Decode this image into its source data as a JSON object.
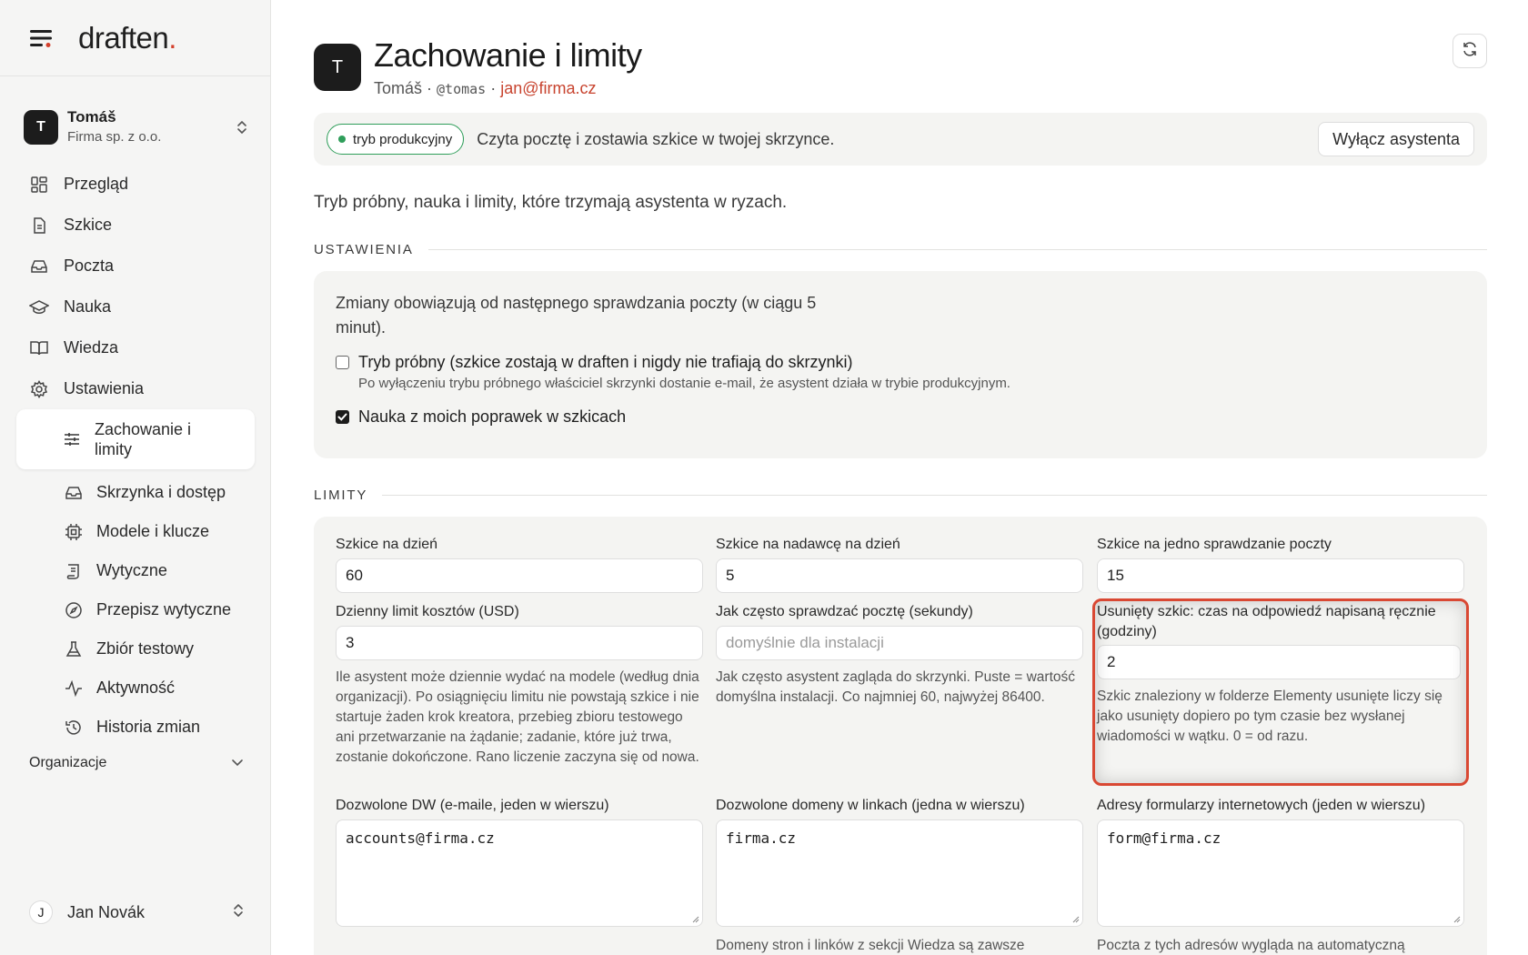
{
  "brand": {
    "name": "draften",
    "dot": "."
  },
  "workspace": {
    "avatar": "T",
    "name": "Tomáš",
    "org": "Firma sp. z o.o."
  },
  "nav": {
    "items": [
      {
        "label": "Przegląd",
        "icon": "dashboard-icon"
      },
      {
        "label": "Szkice",
        "icon": "document-icon"
      },
      {
        "label": "Poczta",
        "icon": "inbox-icon"
      },
      {
        "label": "Nauka",
        "icon": "graduation-cap-icon"
      },
      {
        "label": "Wiedza",
        "icon": "book-icon"
      },
      {
        "label": "Ustawienia",
        "icon": "gear-icon"
      }
    ],
    "sub_items": [
      {
        "label": "Zachowanie i limity",
        "icon": "sliders-icon",
        "active": true
      },
      {
        "label": "Skrzynka i dostęp",
        "icon": "inbox-icon"
      },
      {
        "label": "Modele i klucze",
        "icon": "chip-icon"
      },
      {
        "label": "Wytyczne",
        "icon": "scroll-icon"
      },
      {
        "label": "Przepisz wytyczne",
        "icon": "compass-icon"
      },
      {
        "label": "Zbiór testowy",
        "icon": "flask-icon"
      },
      {
        "label": "Aktywność",
        "icon": "activity-icon"
      },
      {
        "label": "Historia zmian",
        "icon": "history-icon"
      }
    ]
  },
  "org_section": {
    "label": "Organizacje"
  },
  "user": {
    "avatar": "J",
    "name": "Jan Novák"
  },
  "header": {
    "avatar": "T",
    "title": "Zachowanie i limity",
    "name": "Tomáš",
    "sep1": " · ",
    "handle": "@tomas",
    "sep2": " · ",
    "email": "jan@firma.cz"
  },
  "status": {
    "badge": "tryb produkcyjny",
    "text": "Czyta pocztę i zostawia szkice w twojej skrzynce.",
    "button": "Wyłącz asystenta",
    "badge_color": "#2f9e5a"
  },
  "intro": "Tryb próbny, nauka i limity, które trzymają asystenta w ryzach.",
  "settings": {
    "heading": "USTAWIENIA",
    "note": "Zmiany obowiązują od następnego sprawdzania poczty (w ciągu 5 minut).",
    "trial": {
      "label": "Tryb próbny (szkice zostają w draften i nigdy nie trafiają do skrzynki)",
      "help": "Po wyłączeniu trybu próbnego właściciel skrzynki dostanie e-mail, że asystent działa w trybie produkcyjnym.",
      "checked": false
    },
    "learn": {
      "label": "Nauka z moich poprawek w szkicach",
      "checked": true
    }
  },
  "limits": {
    "heading": "LIMITY",
    "drafts_per_day": {
      "label": "Szkice na dzień",
      "value": "60"
    },
    "drafts_per_sender": {
      "label": "Szkice na nadawcę na dzień",
      "value": "5"
    },
    "drafts_per_check": {
      "label": "Szkice na jedno sprawdzanie poczty",
      "value": "15"
    },
    "cost_limit": {
      "label": "Dzienny limit kosztów (USD)",
      "value": "3",
      "help": "Ile asystent może dziennie wydać na modele (według dnia organizacji). Po osiągnięciu limitu nie powstają szkice i nie startuje żaden krok kreatora, przebieg zbioru testowego ani przetwarzanie na żądanie; zadanie, które już trwa, zostanie dokończone. Rano liczenie zaczyna się od nowa."
    },
    "poll_interval": {
      "label": "Jak często sprawdzać pocztę (sekundy)",
      "placeholder": "domyślnie dla instalacji",
      "help": "Jak często asystent zagląda do skrzynki. Puste = wartość domyślna instalacji. Co najmniej 60, najwyżej 86400."
    },
    "deleted_draft": {
      "label": "Usunięty szkic: czas na odpowiedź napisaną ręcznie (godziny)",
      "value": "2",
      "help": "Szkic znaleziony w folderze Elementy usunięte liczy się jako usunięty dopiero po tym czasie bez wysłanej wiadomości w wątku. 0 = od razu."
    },
    "allowed_cc": {
      "label": "Dozwolone DW (e-maile, jeden w wierszu)",
      "value": "accounts@firma.cz"
    },
    "allowed_domains": {
      "label": "Dozwolone domeny w linkach (jedna w wierszu)",
      "value": "firma.cz",
      "help": "Domeny stron i linków z sekcji Wiedza są zawsze"
    },
    "form_addresses": {
      "label": "Adresy formularzy internetowych (jeden w wierszu)",
      "value": "form@firma.cz",
      "help": "Poczta z tych adresów wygląda na automatyczną"
    },
    "highlight_color": "#d94833"
  }
}
